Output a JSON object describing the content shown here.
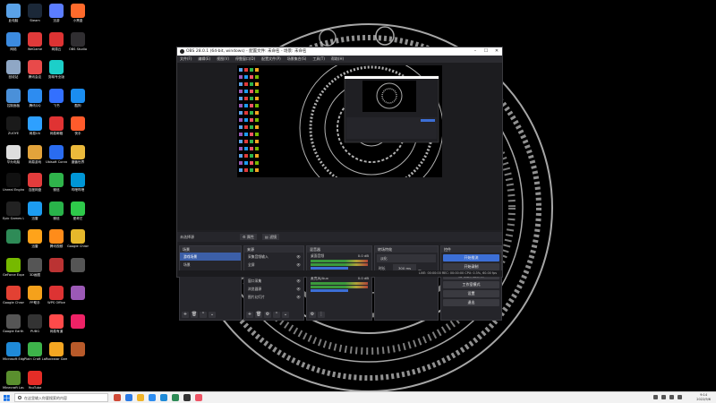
{
  "desktop": {
    "icons": [
      {
        "label": "此电脑",
        "color": "#5aa2e8"
      },
      {
        "label": "Steam",
        "color": "#1b2838"
      },
      {
        "label": "迅游",
        "color": "#5b7dff"
      },
      {
        "label": "小黑盒",
        "color": "#ff6a2b"
      },
      {
        "label": "网络",
        "color": "#3c8be0"
      },
      {
        "label": "WeGame",
        "color": "#e03a3a"
      },
      {
        "label": "网易云",
        "color": "#d33"
      },
      {
        "label": "OBS Studio",
        "color": "#302e31"
      },
      {
        "label": "回收站",
        "color": "#8fa7c5"
      },
      {
        "label": "腾讯会议",
        "color": "#e84a4a"
      },
      {
        "label": "剪映专业版",
        "color": "#1ccfc9"
      },
      {
        "label": "",
        "color": ""
      },
      {
        "label": "控制面板",
        "color": "#4a90d9"
      },
      {
        "label": "腾讯QQ",
        "color": "#2d8cf0"
      },
      {
        "label": "飞书",
        "color": "#3370ff"
      },
      {
        "label": "酷狗",
        "color": "#1a8df0"
      },
      {
        "label": "ZUOYE",
        "color": "#1a1a1a"
      },
      {
        "label": "网易UU",
        "color": "#2ea0ff"
      },
      {
        "label": "网易邮箱",
        "color": "#e03333"
      },
      {
        "label": "快手",
        "color": "#ff5b2b"
      },
      {
        "label": "华为电脑",
        "color": "#ddd"
      },
      {
        "label": "网易游戏",
        "color": "#e2a33b"
      },
      {
        "label": "Ubisoft Connect",
        "color": "#2a6cf0"
      },
      {
        "label": "魔兽世界",
        "color": "#ebb93b"
      },
      {
        "label": "Unreal Engine",
        "color": "#111"
      },
      {
        "label": "百度网盘",
        "color": "#e23c3c"
      },
      {
        "label": "微信",
        "color": "#2fb44b"
      },
      {
        "label": "哔哩哔哩",
        "color": "#0096d6"
      },
      {
        "label": "Epic Games Launcher",
        "color": "#222"
      },
      {
        "label": "迅雷",
        "color": "#1c9cf0"
      },
      {
        "label": "微信",
        "color": "#29b34a"
      },
      {
        "label": "爱奇艺",
        "color": "#2ec94a"
      },
      {
        "label": "",
        "color": "#2e8b57"
      },
      {
        "label": "迅雷",
        "color": "#ffa31a"
      },
      {
        "label": "腾讯视频",
        "color": "#ff8c1a"
      },
      {
        "label": "Google Chrome",
        "color": "#e6b82b"
      },
      {
        "label": "GeForce Experience",
        "color": "#76b900"
      },
      {
        "label": "3D画图",
        "color": "#555"
      },
      {
        "label": "",
        "color": "#b33"
      },
      {
        "label": "",
        "color": "#555"
      },
      {
        "label": "Google Chrome",
        "color": "#e34133"
      },
      {
        "label": "PP助手",
        "color": "#f5a11b"
      },
      {
        "label": "WPS Office",
        "color": "#dd3333"
      },
      {
        "label": "",
        "color": "#9b59b6"
      },
      {
        "label": "Google Earth Pro",
        "color": "#555"
      },
      {
        "label": "PUBG",
        "color": "#333"
      },
      {
        "label": "网易有道",
        "color": "#ff4a4a"
      },
      {
        "label": "",
        "color": "#e26"
      },
      {
        "label": "Microsoft Edge",
        "color": "#1f8ad7"
      },
      {
        "label": "Plain Craft Launcher",
        "color": "#3db34a"
      },
      {
        "label": "Rockstar Games",
        "color": "#f4a621"
      },
      {
        "label": "",
        "color": "#b85a2a"
      },
      {
        "label": "Minecraft Launcher",
        "color": "#5a8f2e"
      },
      {
        "label": "YouTube",
        "color": "#e52d27"
      },
      {
        "label": "",
        "color": ""
      },
      {
        "label": "",
        "color": ""
      }
    ]
  },
  "obs": {
    "title": "OBS 28.0.1 (64-bit, windows) - 配置文件: 未命名 - 场景: 未命名",
    "menu": [
      "文件(F)",
      "编辑(E)",
      "视图(V)",
      "停靠窗口(D)",
      "配置文件(P)",
      "场景集合(S)",
      "工具(T)",
      "帮助(H)"
    ],
    "scene_bar": {
      "label": "未选择源",
      "properties": "属性",
      "filters": "滤镜"
    },
    "docks": {
      "scenes": {
        "title": "场景",
        "items": [
          "游戏场景",
          "场景"
        ],
        "selected": 0
      },
      "sources": {
        "title": "来源",
        "items": [
          "采集音频输入",
          "全屏",
          "显示器采集",
          "窗口采集",
          "浏览器源",
          "图片幻灯片"
        ]
      },
      "mixer": {
        "title": "混音器",
        "channels": [
          {
            "name": "桌面音频",
            "db": "0.0 dB"
          },
          {
            "name": "麦克风/Aux",
            "db": "0.0 dB"
          }
        ]
      },
      "transitions": {
        "title": "转场特效",
        "type": "淡化",
        "duration_label": "时长",
        "duration": "300 ms"
      },
      "controls": {
        "title": "控件",
        "buttons": [
          "开始推流",
          "开始录制",
          "启动虚拟摄像机",
          "工作室模式",
          "设置",
          "退出"
        ]
      }
    },
    "status": "LIVE: 00:00:00   REC: 00:00:00   CPU: 0.3%, 60.00 fps"
  },
  "taskbar": {
    "search_placeholder": "在这里输入你要搜索的内容",
    "time": "9:14",
    "date": "2022/9/6"
  }
}
